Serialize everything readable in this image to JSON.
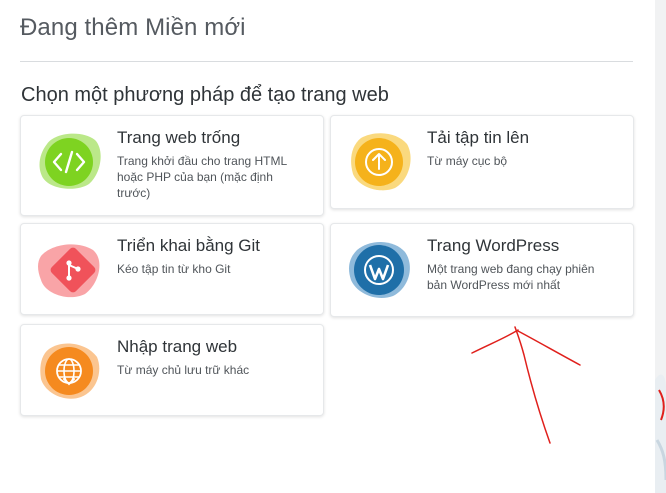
{
  "page": {
    "title": "Đang thêm Miền mới",
    "section_heading": "Chọn một phương pháp để tạo trang web"
  },
  "options": [
    {
      "id": "empty-site",
      "title": "Trang web trống",
      "description": "Trang khởi đầu cho trang HTML hoặc PHP của bạn (mặc định trước)",
      "icon": "code-icon",
      "color": "#7ed321"
    },
    {
      "id": "upload-files",
      "title": "Tải tập tin lên",
      "description": "Từ máy cục bộ",
      "icon": "upload-icon",
      "color": "#f5b21b"
    },
    {
      "id": "git-deploy",
      "title": "Triển khai bằng Git",
      "description": "Kéo tập tin từ kho Git",
      "icon": "git-icon",
      "color": "#f0525a"
    },
    {
      "id": "wordpress-site",
      "title": "Trang WordPress",
      "description": "Một trang web đang chạy phiên bản WordPress mới nhất",
      "icon": "wordpress-icon",
      "color": "#1f6fa8"
    },
    {
      "id": "import-site",
      "title": "Nhập trang web",
      "description": "Từ máy chủ lưu trữ khác",
      "icon": "globe-import-icon",
      "color": "#f58a1f"
    }
  ],
  "colors": {
    "annotation": "#e0201c"
  }
}
